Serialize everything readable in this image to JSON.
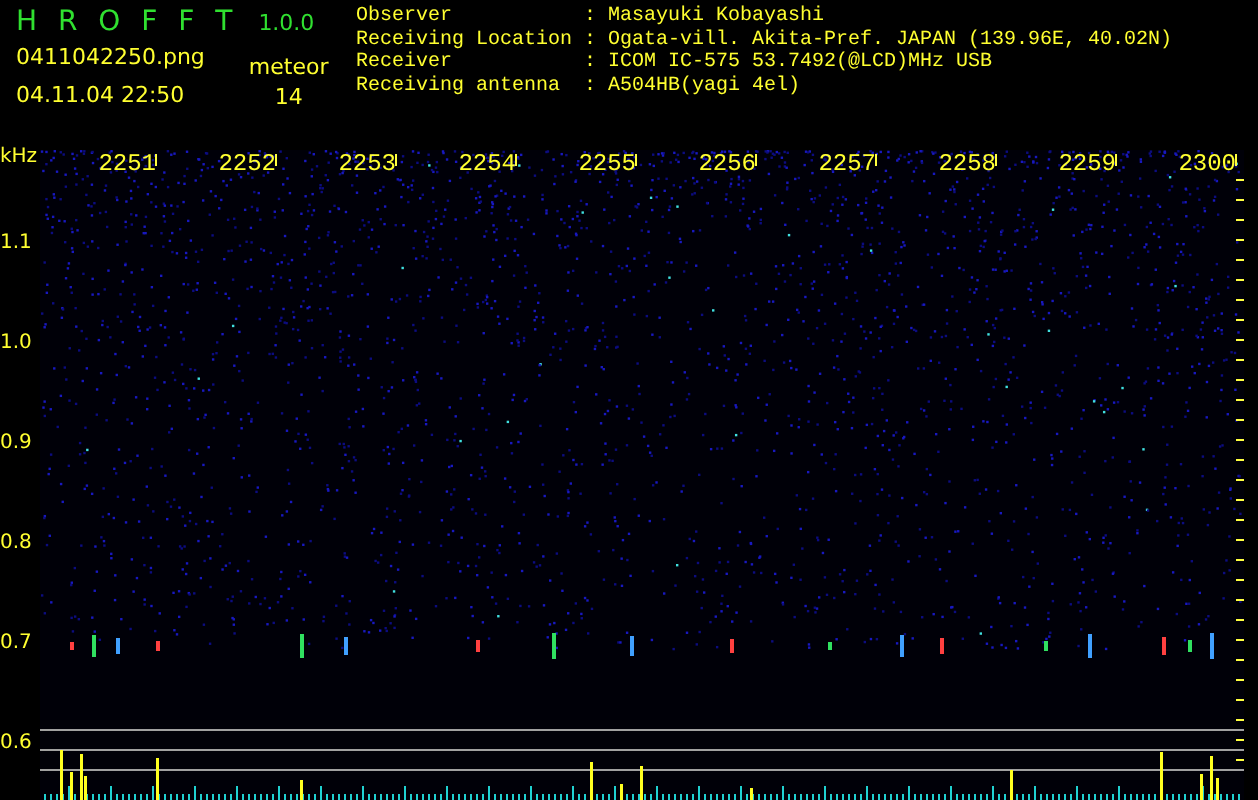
{
  "header": {
    "title": "H R O F F T",
    "version": "1.0.0",
    "filename": "0411042250.png",
    "datetime": "04.11.04 22:50",
    "meteor_label": "meteor",
    "meteor_count": "14"
  },
  "info": [
    {
      "label": "Observer",
      "sep": ":",
      "value": "Masayuki Kobayashi"
    },
    {
      "label": "Receiving Location",
      "sep": ":",
      "value": "Ogata-vill. Akita-Pref. JAPAN (139.96E, 40.02N)"
    },
    {
      "label": "Receiver",
      "sep": ":",
      "value": "ICOM IC-575 53.7492(@LCD)MHz USB"
    },
    {
      "label": "Receiving antenna",
      "sep": ":",
      "value": "A504HB(yagi 4el)"
    }
  ],
  "plot": {
    "unit": "kHz",
    "x_labels": [
      "2251",
      "2252",
      "2253",
      "2254",
      "2255",
      "2256",
      "2257",
      "2258",
      "2259",
      "2300"
    ],
    "y_labels": [
      "1.1",
      "1.0",
      "0.9",
      "0.8",
      "0.7",
      "0.6"
    ]
  }
}
